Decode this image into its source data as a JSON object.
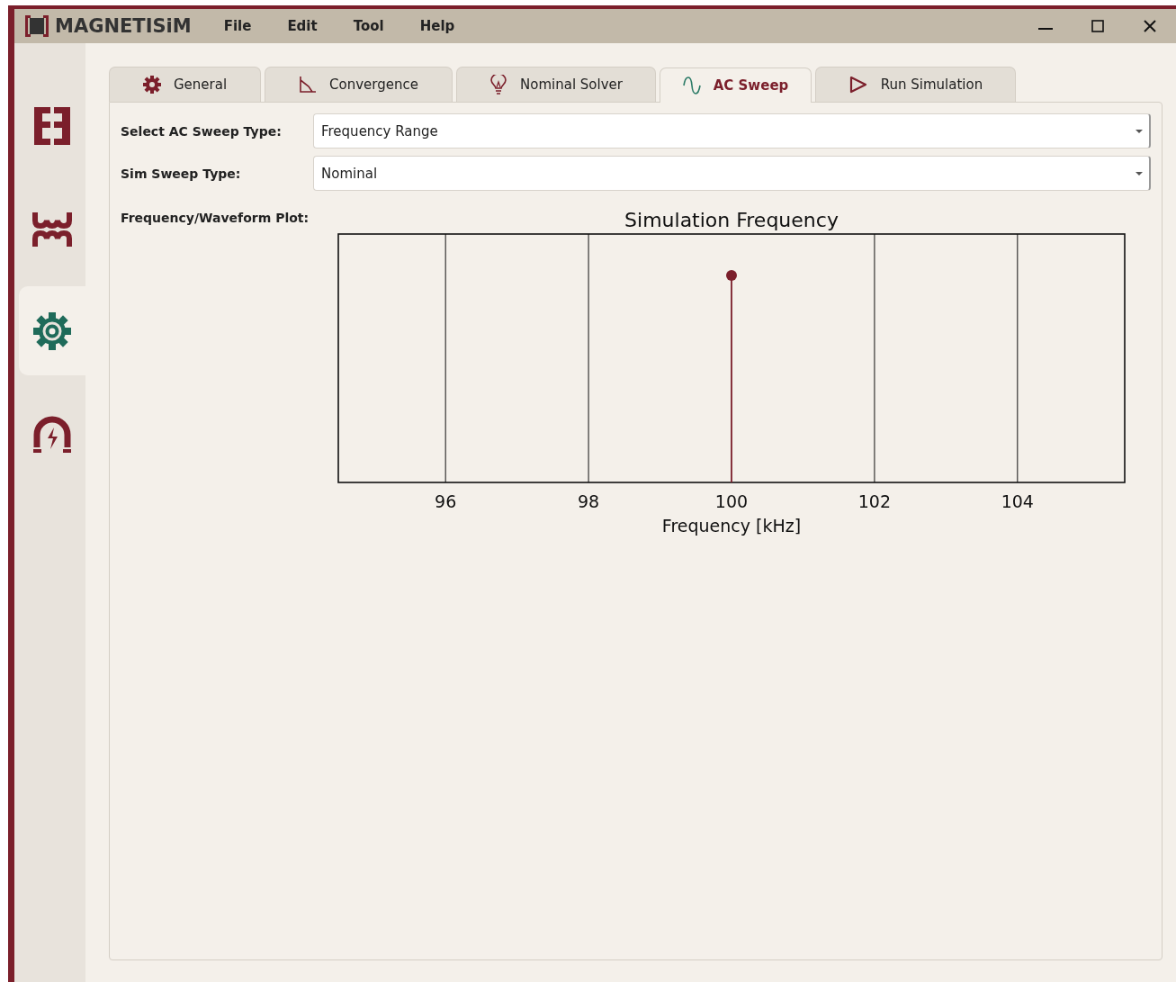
{
  "app": {
    "logo_text": "MAGNETISiM"
  },
  "menu": [
    "File",
    "Edit",
    "Tool",
    "Help"
  ],
  "sidebar": {
    "items": [
      {
        "kind": "core",
        "selected": false
      },
      {
        "kind": "winding",
        "selected": false
      },
      {
        "kind": "settings",
        "selected": true
      },
      {
        "kind": "magnet",
        "selected": false
      }
    ]
  },
  "tabs": [
    {
      "label": "General",
      "kind": "gear",
      "selected": false
    },
    {
      "label": "Convergence",
      "kind": "convergence",
      "selected": false
    },
    {
      "label": "Nominal Solver",
      "kind": "bulb",
      "selected": false
    },
    {
      "label": "AC Sweep",
      "kind": "wave",
      "selected": true
    },
    {
      "label": "Run Simulation",
      "kind": "play",
      "selected": false
    }
  ],
  "form": [
    {
      "label": "Select AC Sweep Type:",
      "value": "Frequency Range"
    },
    {
      "label": "Sim Sweep Type:",
      "value": "Nominal"
    }
  ],
  "plot": {
    "label": "Frequency/Waveform Plot:",
    "title": "Simulation Frequency",
    "xlabel": "Frequency [kHz]",
    "tick_labels": [
      "96",
      "98",
      "100",
      "102",
      "104"
    ]
  }
}
